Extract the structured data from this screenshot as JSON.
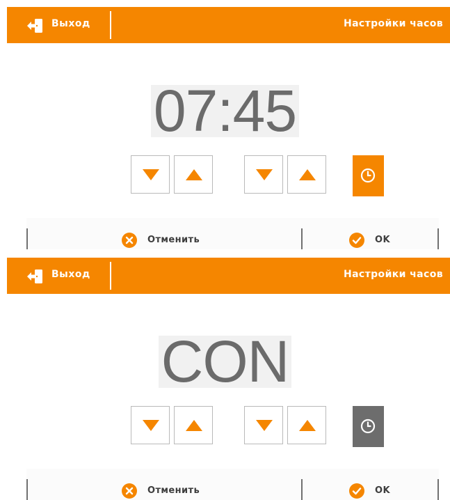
{
  "colors": {
    "accent": "#f58600",
    "clock_active": "#f58600",
    "clock_inactive": "#6d6d6d",
    "display_text": "#6b6b6b"
  },
  "panels": [
    {
      "header": {
        "exit_label": "Выход",
        "title": "Настройки часов"
      },
      "display": "07:45",
      "clock_state": "active",
      "footer": {
        "cancel_label": "Отменить",
        "ok_label": "OK"
      }
    },
    {
      "header": {
        "exit_label": "Выход",
        "title": "Настройки часов"
      },
      "display": "CON",
      "clock_state": "inactive",
      "footer": {
        "cancel_label": "Отменить",
        "ok_label": "OK"
      }
    }
  ],
  "icons": {
    "exit": "exit-door-icon",
    "down": "arrow-down-icon",
    "up": "arrow-up-icon",
    "clock": "clock-icon",
    "cancel": "cancel-x-icon",
    "ok": "check-icon"
  }
}
